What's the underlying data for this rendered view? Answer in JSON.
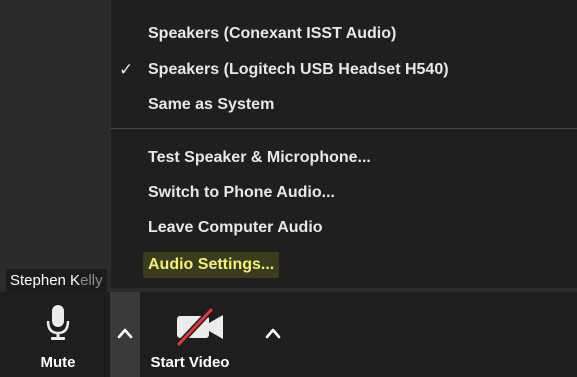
{
  "menu": {
    "items": [
      {
        "label": "Speakers (Conexant ISST Audio)",
        "checked": false
      },
      {
        "label": "Speakers (Logitech USB Headset H540)",
        "checked": true
      },
      {
        "label": "Same as System",
        "checked": false
      }
    ],
    "actions": [
      {
        "label": "Test Speaker & Microphone..."
      },
      {
        "label": "Switch to Phone Audio..."
      },
      {
        "label": "Leave Computer Audio"
      },
      {
        "label": "Audio Settings..."
      }
    ],
    "check_glyph": "✓"
  },
  "participant": {
    "name_visible": "Stephen K",
    "name_faded": "elly"
  },
  "toolbar": {
    "mute_label": "Mute",
    "video_label": "Start Video"
  },
  "icons": {
    "microphone": "microphone-icon",
    "video_off": "video-off-icon",
    "caret_up": "caret-up-icon"
  },
  "colors": {
    "highlight_text": "#f2f27a",
    "video_off_slash": "#e0393e"
  }
}
